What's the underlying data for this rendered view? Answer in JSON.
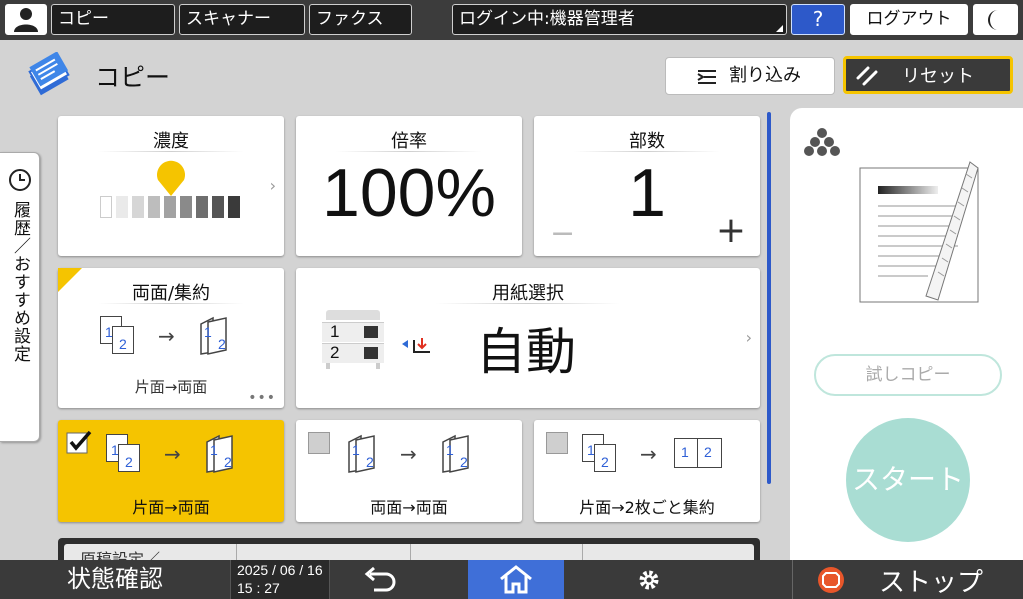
{
  "topbar": {
    "copy_label": "コピー",
    "scanner_label": "スキャナー",
    "fax_label": "ファクス",
    "login_status": "ログイン中:機器管理者",
    "help_label": "?",
    "logout_label": "ログアウト"
  },
  "header": {
    "title": "コピー",
    "interrupt_label": "割り込み",
    "reset_label": "リセット"
  },
  "side_tab": {
    "label": "履歴／おすすめ設定"
  },
  "cards": {
    "density": {
      "title": "濃度",
      "level": 0.5
    },
    "ratio": {
      "title": "倍率",
      "value": "100%"
    },
    "copies": {
      "title": "部数",
      "value": "1",
      "minus": "−",
      "plus": "+"
    },
    "duplex": {
      "title": "両面/集約",
      "caption": "片面→両面",
      "num1": "1",
      "num2": "2",
      "num3": "1",
      "num4": "2"
    },
    "paper": {
      "title": "用紙選択",
      "value": "自動",
      "tray1": "1",
      "tray2": "2"
    }
  },
  "presets": [
    {
      "label": "片面→両面",
      "checked": true,
      "n1": "1",
      "n2": "2",
      "n3": "1",
      "n4": "2"
    },
    {
      "label": "両面→両面",
      "checked": false,
      "n1": "1",
      "n2": "2",
      "n3": "1",
      "n4": "2"
    },
    {
      "label": "片面→2枚ごと集約",
      "checked": false,
      "n1": "1",
      "n2": "2",
      "n3": "1",
      "n4": "2"
    }
  ],
  "lower_tab": {
    "label": "原稿設定／"
  },
  "right_panel": {
    "sample_copy_label": "試しコピー",
    "start_label": "スタート"
  },
  "bottombar": {
    "status_label": "状態確認",
    "date": "2025 / 06 / 16",
    "time": "15 : 27",
    "stop_label": "ストップ"
  },
  "colors": {
    "accent_yellow": "#f5c400",
    "start_teal": "#a9ddd3",
    "help_blue": "#2d59c9",
    "home_blue": "#3f6fd8"
  }
}
